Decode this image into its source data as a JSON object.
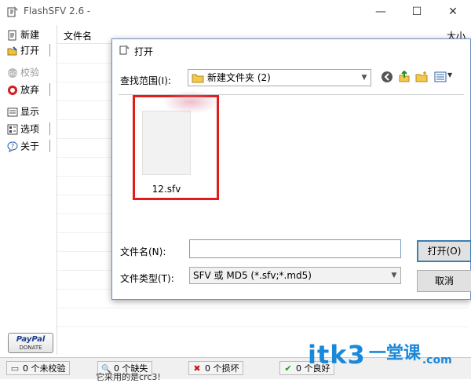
{
  "window": {
    "title": "FlashSFV 2.6  -",
    "controls": {
      "minimize": "—",
      "maximize": "☐",
      "close": "✕"
    }
  },
  "toolbar": {
    "items": [
      {
        "label": "新建",
        "icon": "new-file-icon"
      },
      {
        "label": "打开",
        "icon": "open-folder-icon"
      },
      {
        "label": "校验",
        "icon": "verify-icon",
        "disabled": true
      },
      {
        "label": "放弃",
        "icon": "abort-icon"
      },
      {
        "label": "显示",
        "icon": "display-icon"
      },
      {
        "label": "选项",
        "icon": "options-icon"
      },
      {
        "label": "关于",
        "icon": "about-icon"
      }
    ]
  },
  "list": {
    "columns": [
      "文件名",
      "大小"
    ]
  },
  "paypal": {
    "brand": "PayPal",
    "sub": "DONATE"
  },
  "status": {
    "items": [
      {
        "icon": "unverified-icon",
        "symbol": "▭",
        "text": "0 个未校验",
        "color": "#444444"
      },
      {
        "icon": "missing-icon",
        "symbol": "🔍",
        "text": "0 个缺失",
        "color": "#2a5fa5"
      },
      {
        "icon": "damaged-icon",
        "symbol": "✖",
        "text": "0 个损坏",
        "color": "#d01010"
      },
      {
        "icon": "good-icon",
        "symbol": "✔",
        "text": "0 个良好",
        "color": "#1a9a1a"
      }
    ]
  },
  "overflow_text": "它采用的是crc3!",
  "watermark": {
    "main": "itk3",
    "sub": "一堂课",
    "sub2": ".com"
  },
  "dialog": {
    "title": "打开",
    "look_in_label": "查找范围(I):",
    "look_in_value": "新建文件夹 (2)",
    "nav_icons": [
      "back-icon",
      "up-folder-icon",
      "new-folder-icon",
      "view-menu-icon"
    ],
    "file": {
      "name": "12.sfv"
    },
    "filename_label": "文件名(N):",
    "filename_value": "",
    "filetype_label": "文件类型(T):",
    "filetype_value": "SFV 或 MD5 (*.sfv;*.md5)",
    "open_button": "打开(O)",
    "cancel_button": "取消"
  },
  "colors": {
    "highlight": "#e41b1b",
    "dialog_border": "#6f8fbf",
    "watermark": "#1a88d8",
    "primary_button_border": "#3c7fb1"
  }
}
